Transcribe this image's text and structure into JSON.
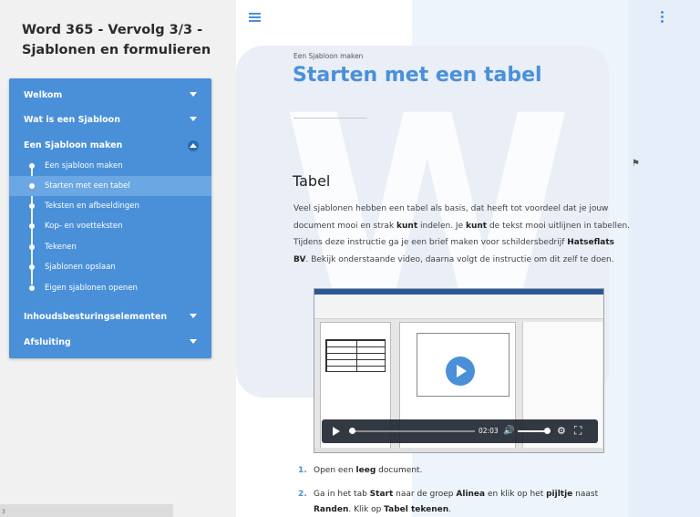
{
  "course": {
    "title": "Word 365 - Vervolg 3/3 - Sjablonen en formulieren"
  },
  "menu": {
    "sections": [
      {
        "label": "Welkom"
      },
      {
        "label": "Wat is een Sjabloon"
      },
      {
        "label": "Een Sjabloon maken"
      },
      {
        "label": "Inhoudsbesturingselementen"
      },
      {
        "label": "Afsluiting"
      }
    ],
    "subitems": [
      {
        "label": "Een sjabloon maken"
      },
      {
        "label": "Starten met een tabel",
        "active": true
      },
      {
        "label": "Teksten en afbeeldingen"
      },
      {
        "label": "Kop- en voetteksten"
      },
      {
        "label": "Tekenen"
      },
      {
        "label": "Sjablonen opslaan"
      },
      {
        "label": "Eigen sjablonen openen"
      }
    ]
  },
  "bottom_bar": {
    "text": "3"
  },
  "lesson": {
    "breadcrumb": "Een Sjabloon maken",
    "title": "Starten met een tabel",
    "section_heading": "Tabel",
    "para": {
      "t1": "Veel sjablonen hebben een tabel als basis, dat heeft tot voordeel dat je jouw document mooi en strak ",
      "b1": "kunt",
      "t2": " indelen. Je ",
      "b2": "kunt",
      "t3": " de tekst mooi uitlijnen in tabellen. Tijdens deze instructie ga je een brief maken voor schildersbedrijf ",
      "b3": "Hatseflats BV",
      "t4": ". Bekijk onderstaande video, daarna volgt de instructie om dit zelf te doen."
    },
    "video": {
      "time": "02:03"
    },
    "steps": [
      {
        "num": "1.",
        "a": "Open een ",
        "b": "leeg",
        "c": " document."
      },
      {
        "num": "2.",
        "a": "Ga in het tab ",
        "b": "Start",
        "c": " naar de groep ",
        "d": "Alinea",
        "e": " en klik op het ",
        "f": "pijltje",
        "g": " naast ",
        "h": "Randen",
        "i": ". Klik op ",
        "j": "Tabel tekenen",
        "k": "."
      }
    ]
  },
  "colors": {
    "accent": "#4a90d9",
    "menu_bg": "#4a90d9"
  }
}
